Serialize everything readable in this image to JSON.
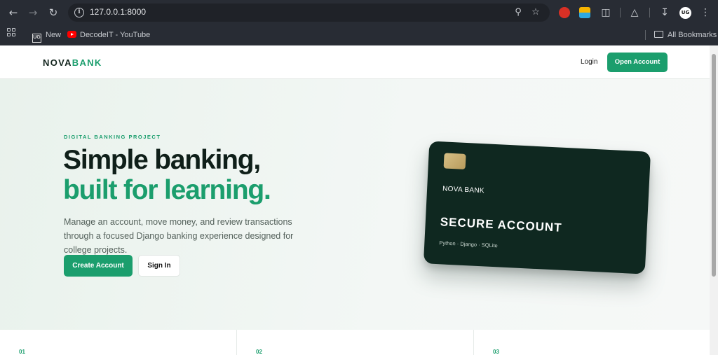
{
  "browser": {
    "url": "127.0.0.1:8000",
    "bookmarks": [
      {
        "label": "New"
      },
      {
        "label": "DecodeIT - YouTube"
      }
    ],
    "all_bookmarks_label": "All Bookmarks",
    "profile_initials": "UG"
  },
  "header": {
    "logo_primary": "NOVA",
    "logo_accent": "BANK",
    "login_label": "Login",
    "open_account_label": "Open Account"
  },
  "hero": {
    "eyebrow": "DIGITAL BANKING PROJECT",
    "headline_line1": "Simple banking,",
    "headline_line2": "built for learning.",
    "lead": "Manage an account, move money, and review transactions through a focused Django banking experience designed for college projects.",
    "create_account_label": "Create Account",
    "sign_in_label": "Sign In"
  },
  "card": {
    "bank_name": "NOVA BANK",
    "title": "SECURE ACCOUNT",
    "tech": "Python · Django · SQLite"
  },
  "features": [
    {
      "number": "01"
    },
    {
      "number": "02"
    },
    {
      "number": "03"
    }
  ],
  "colors": {
    "accent": "#1b9e6d",
    "dark": "#0f1f19",
    "card": "#0f2820"
  }
}
